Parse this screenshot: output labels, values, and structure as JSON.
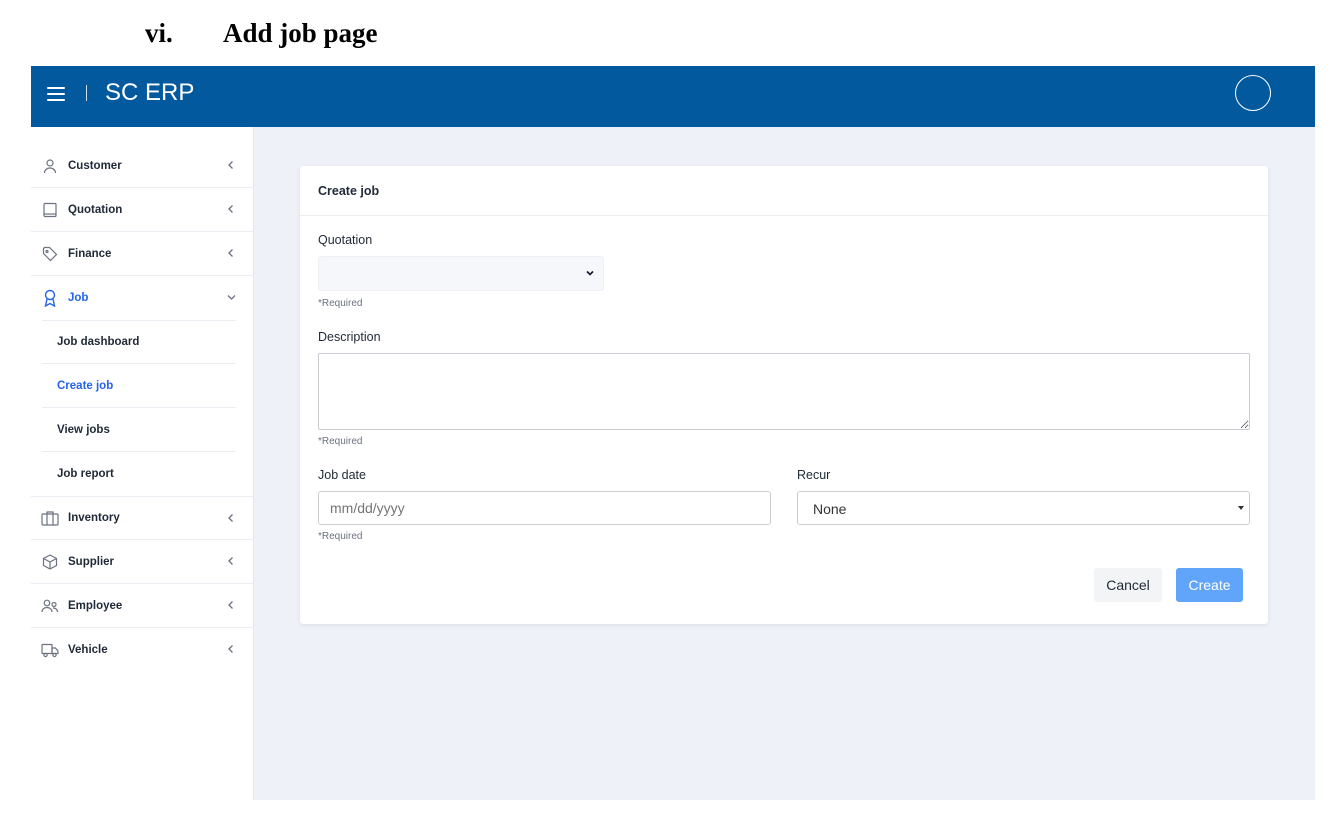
{
  "doc": {
    "number": "vi.",
    "title": "Add job page"
  },
  "header": {
    "brand": "SC ERP"
  },
  "sidebar": {
    "items": [
      {
        "label": "Customer",
        "icon": "user-icon"
      },
      {
        "label": "Quotation",
        "icon": "book-icon"
      },
      {
        "label": "Finance",
        "icon": "tag-icon"
      },
      {
        "label": "Job",
        "icon": "award-icon",
        "expanded": true
      },
      {
        "label": "Inventory",
        "icon": "briefcase-icon"
      },
      {
        "label": "Supplier",
        "icon": "box-icon"
      },
      {
        "label": "Employee",
        "icon": "users-icon"
      },
      {
        "label": "Vehicle",
        "icon": "truck-icon"
      }
    ],
    "job_subitems": [
      {
        "label": "Job dashboard"
      },
      {
        "label": "Create job",
        "current": true
      },
      {
        "label": "View jobs"
      },
      {
        "label": "Job report"
      }
    ]
  },
  "form": {
    "title": "Create job",
    "quotation_label": "Quotation",
    "quotation_value": "",
    "required_text": "*Required",
    "description_label": "Description",
    "description_value": "",
    "job_date_label": "Job date",
    "job_date_placeholder": "mm/dd/yyyy",
    "recur_label": "Recur",
    "recur_value": "None",
    "cancel_label": "Cancel",
    "create_label": "Create"
  },
  "colors": {
    "header_bg": "#02599e",
    "accent": "#2563eb",
    "create_button": "#60a5fa",
    "page_bg": "#eef1f7"
  }
}
